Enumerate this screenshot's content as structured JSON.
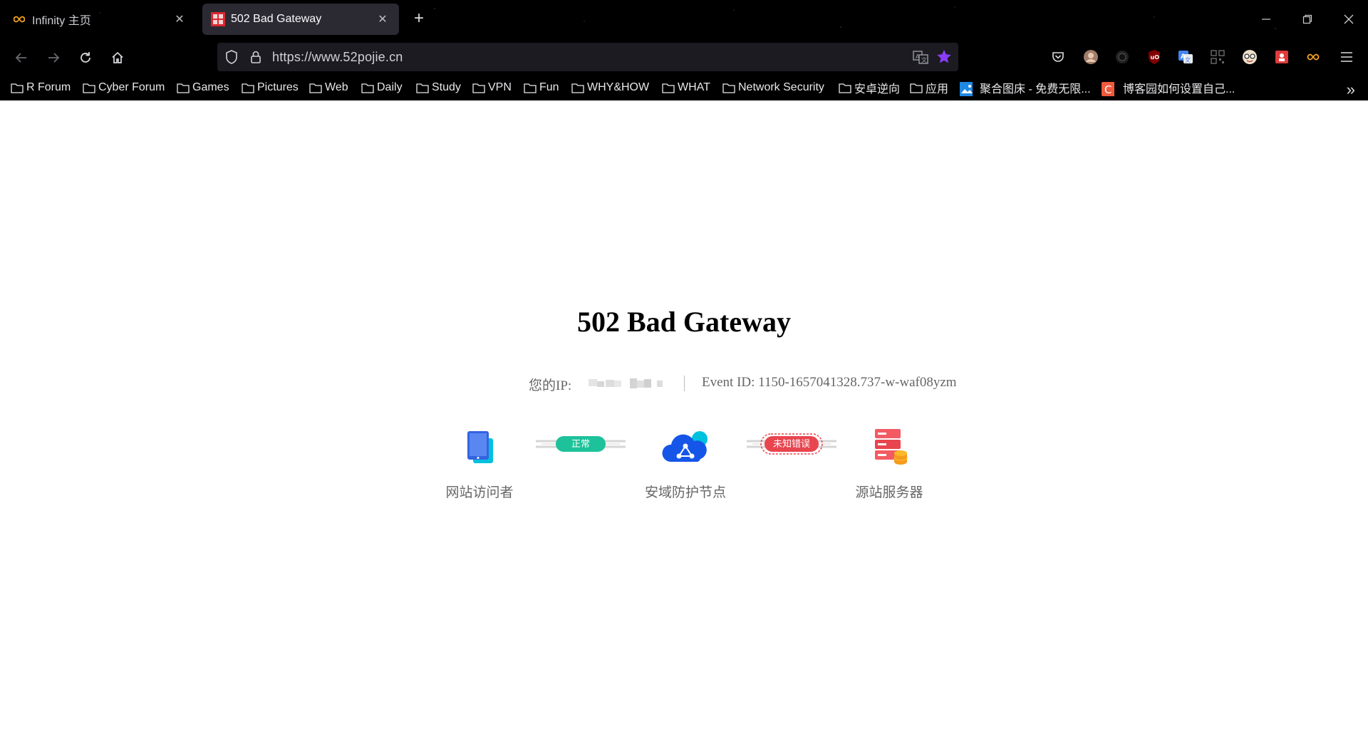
{
  "browser": {
    "tabs": [
      {
        "title": "Infinity 主页",
        "active": false,
        "icon": "infinity-icon"
      },
      {
        "title": "502 Bad Gateway",
        "active": true,
        "icon": "52pojie-favicon"
      }
    ],
    "url": "https://www.52pojie.cn",
    "bookmarks": [
      {
        "label": "R Forum",
        "type": "folder"
      },
      {
        "label": "Cyber Forum",
        "type": "folder"
      },
      {
        "label": "Games",
        "type": "folder"
      },
      {
        "label": "Pictures",
        "type": "folder"
      },
      {
        "label": "Web",
        "type": "folder"
      },
      {
        "label": "Daily",
        "type": "folder"
      },
      {
        "label": "Study",
        "type": "folder"
      },
      {
        "label": "VPN",
        "type": "folder"
      },
      {
        "label": "Fun",
        "type": "folder"
      },
      {
        "label": "WHY&HOW",
        "type": "folder"
      },
      {
        "label": "WHAT",
        "type": "folder"
      },
      {
        "label": "Network Security",
        "type": "folder"
      },
      {
        "label": "安卓逆向",
        "type": "folder"
      },
      {
        "label": "应用",
        "type": "folder"
      },
      {
        "label": "聚合图床 - 免费无限...",
        "type": "link"
      },
      {
        "label": "博客园如何设置自己...",
        "type": "link"
      }
    ],
    "colors": {
      "chrome_bg": "#000000",
      "active_tab": "#2b2a33",
      "urlbar_bg": "#1c1b22",
      "star": "#8b3cf7"
    }
  },
  "page": {
    "heading": "502 Bad Gateway",
    "ip_label": "您的IP:",
    "event_id": "Event ID: 1150-1657041328.737-w-waf08yzm",
    "flow": {
      "visitor_label": "网站访问者",
      "node_label": "安域防护节点",
      "origin_label": "源站服务器",
      "status_ok": "正常",
      "status_error": "未知错误",
      "ok_color": "#1dc29a",
      "error_color": "#e8454f"
    }
  }
}
